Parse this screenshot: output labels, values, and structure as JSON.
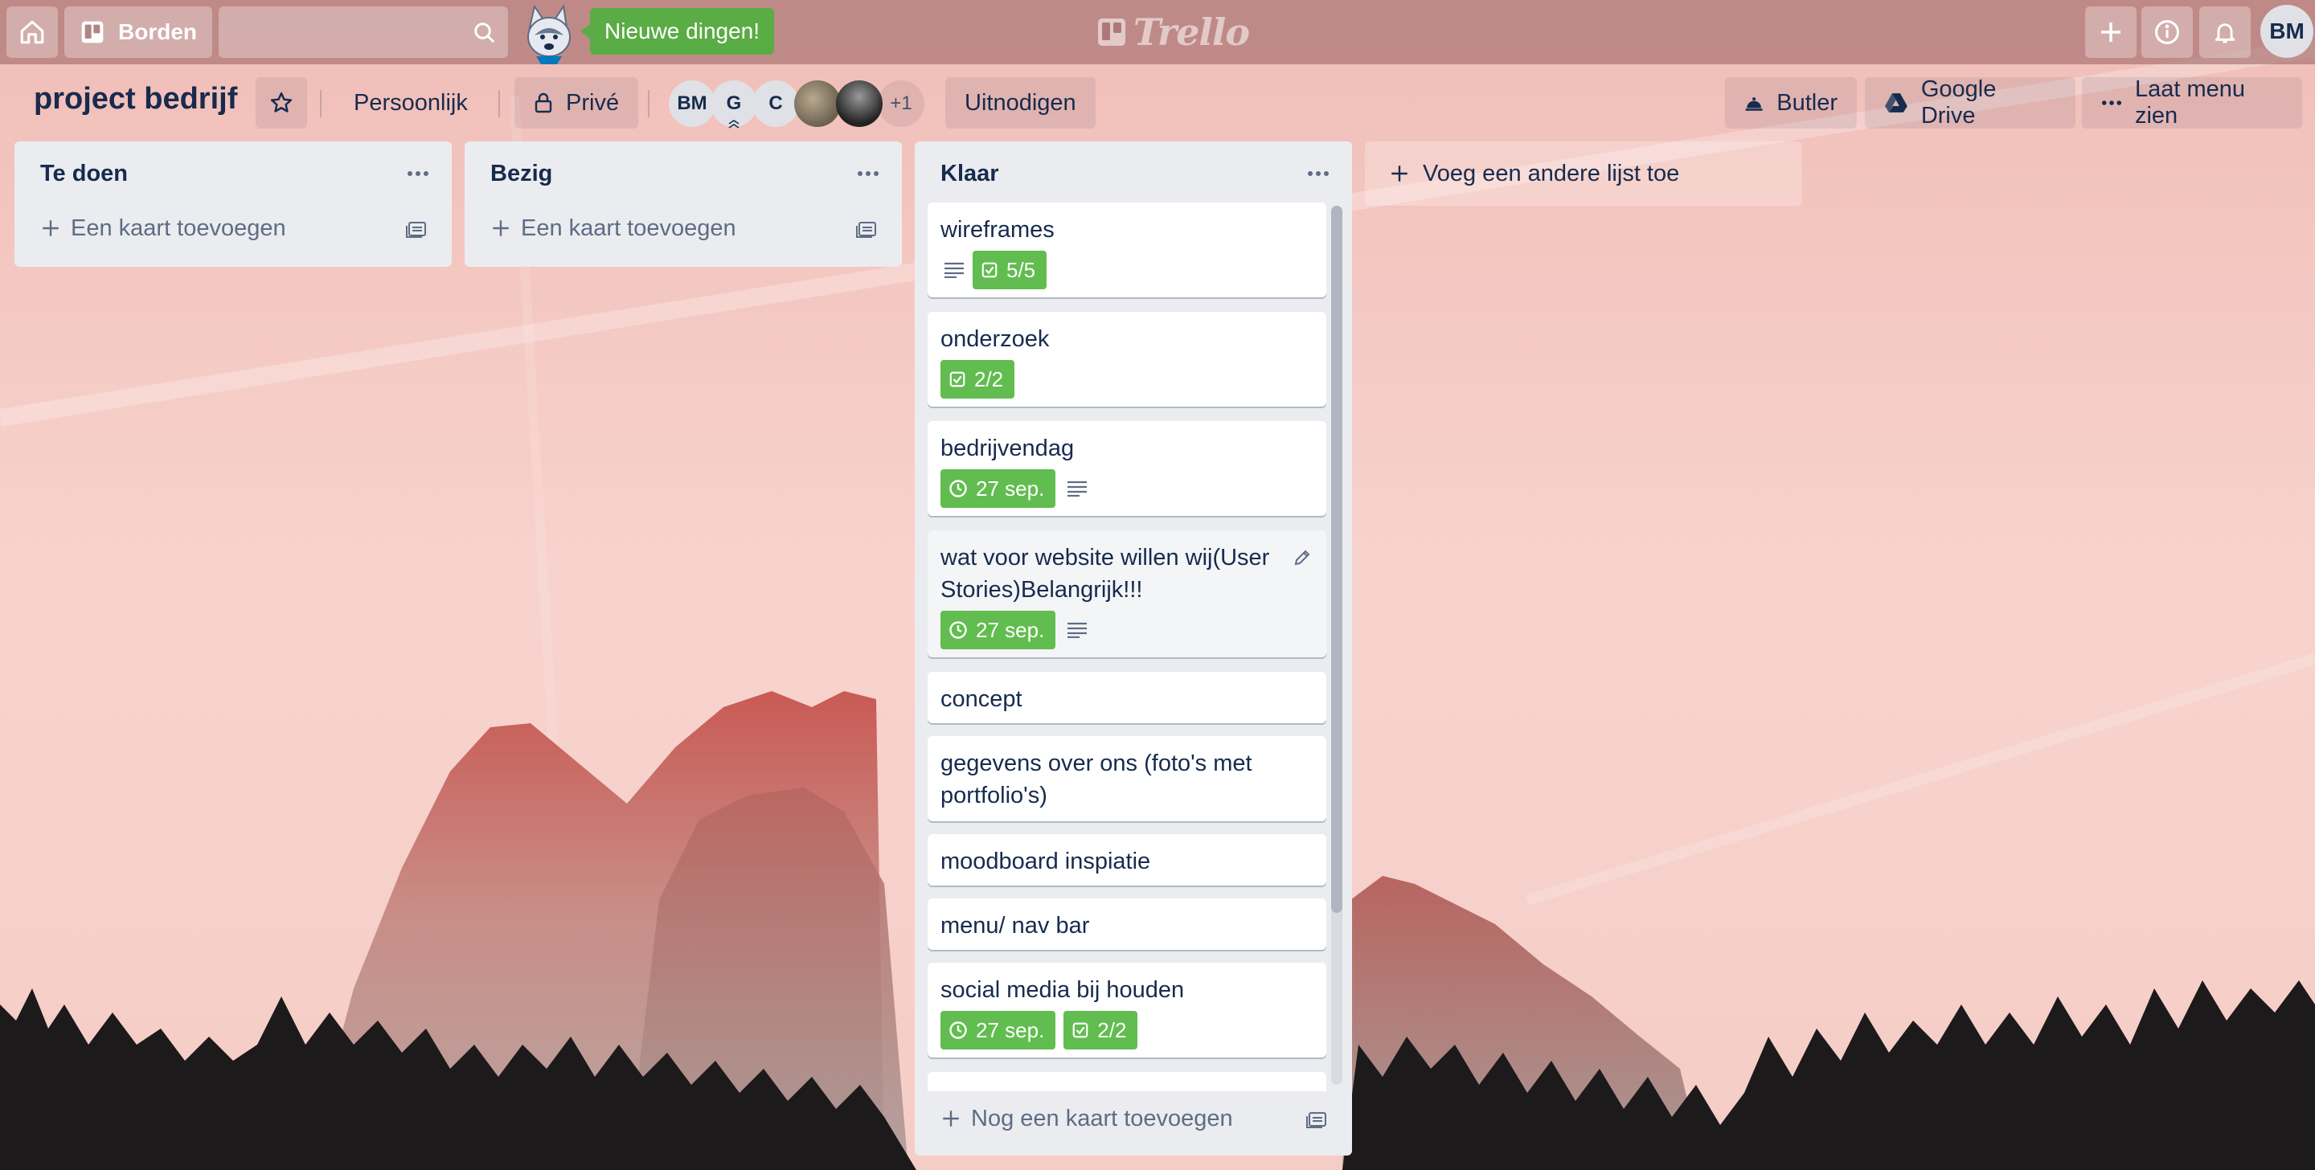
{
  "topbar": {
    "boards_label": "Borden",
    "search_placeholder": "",
    "whats_new_label": "Nieuwe dingen!",
    "logo_text": "Trello",
    "user_initials": "BM"
  },
  "board": {
    "title": "project bedrijf",
    "team_label": "Persoonlijk",
    "visibility_label": "Privé",
    "invite_label": "Uitnodigen",
    "members": [
      "BM",
      "G",
      "C"
    ],
    "members_more": "+1",
    "butler_label": "Butler",
    "drive_label": "Google Drive",
    "menu_label": "Laat menu zien"
  },
  "lists": [
    {
      "title": "Te doen",
      "add_card_label": "Een kaart toevoegen"
    },
    {
      "title": "Bezig",
      "add_card_label": "Een kaart toevoegen"
    },
    {
      "title": "Klaar",
      "add_card_label": "Nog een kaart toevoegen",
      "cards": [
        {
          "title": "wireframes",
          "checklist": "5/5"
        },
        {
          "title": "onderzoek",
          "checklist": "2/2"
        },
        {
          "title": "bedrijvendag",
          "due": "27 sep."
        },
        {
          "title": "wat voor website willen wij(User Stories)Belangrijk!!!",
          "due": "27 sep."
        },
        {
          "title": "concept"
        },
        {
          "title": "gegevens over ons (foto's met portfolio's)"
        },
        {
          "title": "moodboard inspiatie"
        },
        {
          "title": "menu/ nav bar"
        },
        {
          "title": "social media bij houden",
          "due": "27 sep.",
          "checklist": "2/2"
        }
      ]
    }
  ],
  "add_list_label": "Voeg een andere lijst toe",
  "colors": {
    "badge_green": "#61bd4f",
    "whats_new_green": "#5aac44",
    "list_bg": "#ebecf0",
    "text": "#172b4d"
  }
}
